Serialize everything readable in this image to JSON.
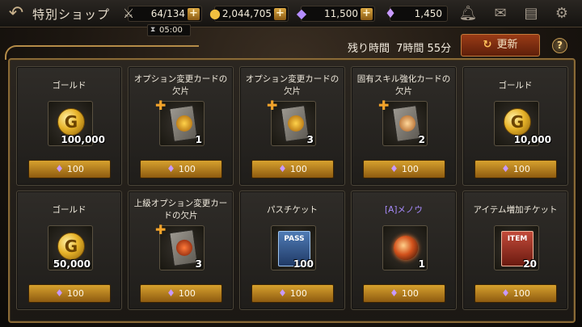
{
  "header": {
    "back_icon": "back-arrow-icon",
    "title": "特別ショップ",
    "stamina": {
      "icon": "stamina-icon",
      "value": "64/134"
    },
    "stamina_timer": "05:00",
    "gold": {
      "icon": "gold-coin-icon",
      "value": "2,044,705"
    },
    "gems": {
      "icon": "gem-icon",
      "value": "11,500"
    },
    "special": {
      "icon": "purple-crystal-icon",
      "value": "1,450"
    },
    "icons": [
      "bell-icon",
      "mail-icon",
      "chat-icon",
      "gear-icon"
    ]
  },
  "subheader": {
    "remaining_label": "残り時間",
    "remaining_value": "7時間 55分",
    "refresh_label": "更新",
    "help_label": "?"
  },
  "items": [
    {
      "name": "ゴールド",
      "icon": "gold-coin-icon",
      "qty": "100,000",
      "price": "100"
    },
    {
      "name": "オプション変更カードの欠片",
      "icon": "card-fragment-icon",
      "qty": "1",
      "price": "100"
    },
    {
      "name": "オプション変更カードの欠片",
      "icon": "card-fragment-icon",
      "qty": "3",
      "price": "100"
    },
    {
      "name": "固有スキル強化カードの欠片",
      "icon": "skill-card-fragment-icon",
      "qty": "2",
      "price": "100"
    },
    {
      "name": "ゴールド",
      "icon": "gold-coin-icon",
      "qty": "10,000",
      "price": "100"
    },
    {
      "name": "ゴールド",
      "icon": "gold-coin-icon",
      "qty": "50,000",
      "price": "100"
    },
    {
      "name": "上級オプション変更カードの欠片",
      "icon": "advanced-card-fragment-icon",
      "qty": "3",
      "price": "100"
    },
    {
      "name": "パスチケット",
      "icon": "pass-ticket-icon",
      "qty": "100",
      "price": "100",
      "label": "PASS"
    },
    {
      "name": "[A]メノウ",
      "icon": "agate-orb-icon",
      "qty": "1",
      "price": "100"
    },
    {
      "name": "アイテム増加チケット",
      "icon": "item-ticket-icon",
      "qty": "20",
      "price": "100",
      "label": "ITEM"
    }
  ],
  "colors": {
    "accent_gold": "#d7a12e",
    "refresh_red": "#9a3b16",
    "purple_name": "#a98cff"
  }
}
